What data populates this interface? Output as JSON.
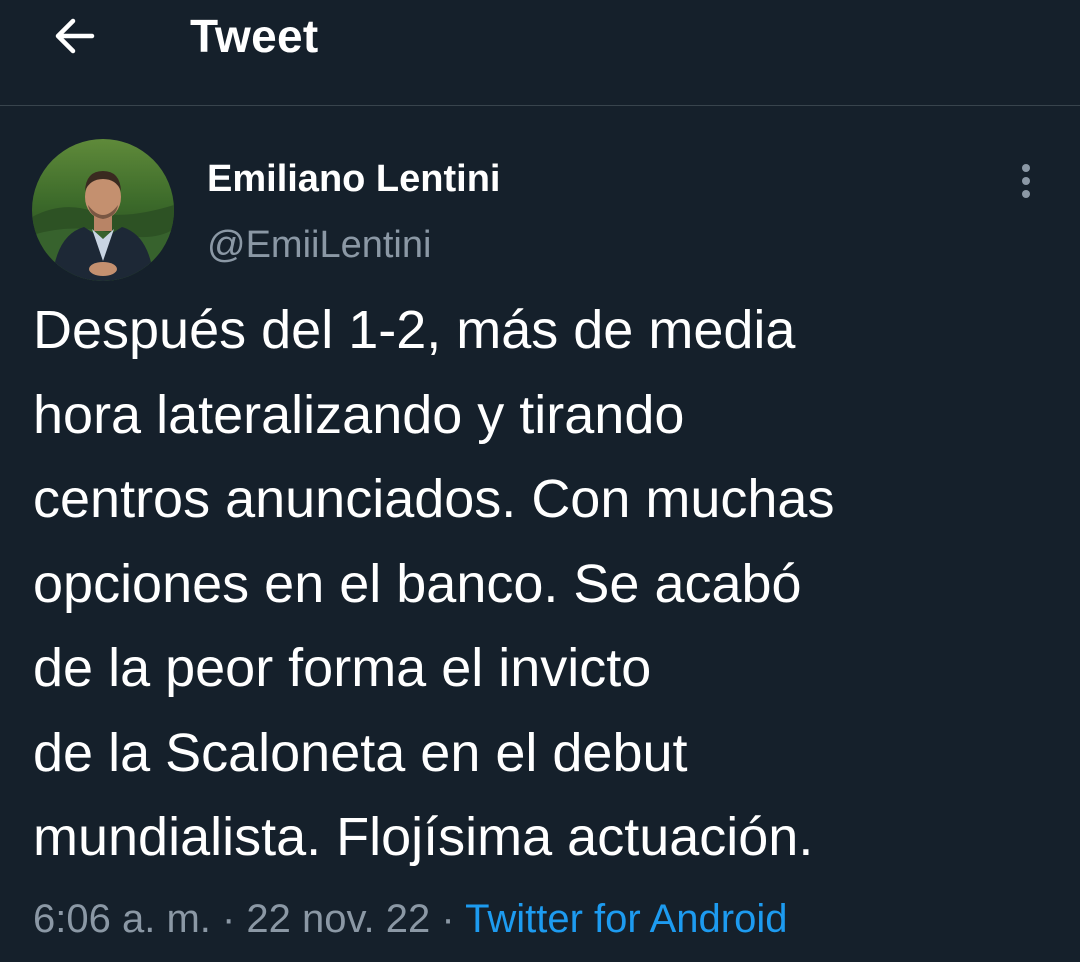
{
  "header": {
    "title": "Tweet",
    "back_icon": "arrow-left-icon"
  },
  "author": {
    "name": "Emiliano Lentini",
    "handle": "@EmiiLentini",
    "avatar_icon": "avatar-photo"
  },
  "tweet": {
    "lines": [
      "Después del 1-2, más de media",
      "hora lateralizando y tirando",
      "centros anunciados. Con muchas",
      "opciones en el banco. Se acabó",
      "de la peor forma el invicto",
      "de la Scaloneta en el debut",
      "mundialista. Flojísima actuación."
    ]
  },
  "meta": {
    "time": "6:06 a. m.",
    "separator": " · ",
    "date": "22 nov. 22",
    "source": "Twitter for Android"
  },
  "colors": {
    "background": "#15202b",
    "text": "#ffffff",
    "muted": "#8b98a5",
    "accent": "#1d9bf0",
    "divider": "#38444d"
  },
  "icons": {
    "more": "more-vertical-icon"
  }
}
